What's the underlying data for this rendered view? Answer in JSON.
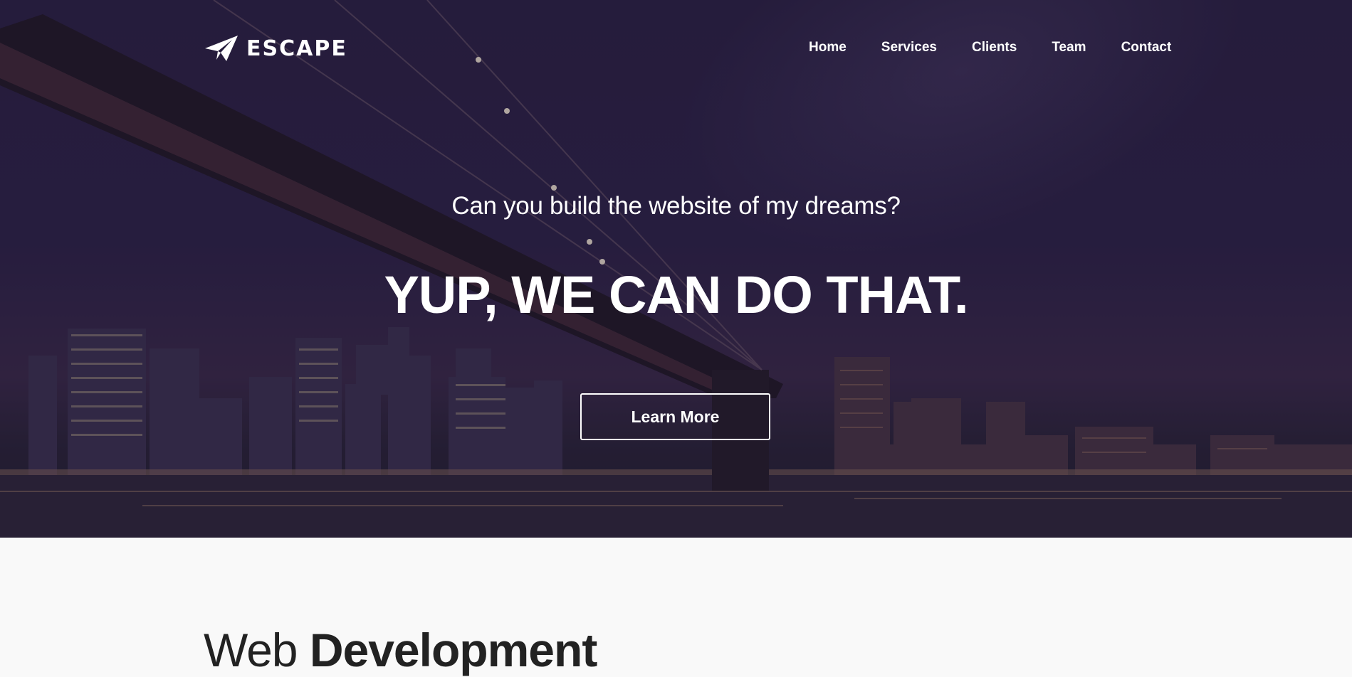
{
  "header": {
    "logo_text": "ESCAPE",
    "logo_icon": "paper-plane-icon",
    "nav": [
      {
        "label": "Home"
      },
      {
        "label": "Services"
      },
      {
        "label": "Clients"
      },
      {
        "label": "Team"
      },
      {
        "label": "Contact"
      }
    ]
  },
  "hero": {
    "subtitle": "Can you build the website of my dreams?",
    "title": "YUP, WE CAN DO THAT.",
    "button_label": "Learn More",
    "background": "night-city-bridge-photo"
  },
  "section": {
    "heading_light": "Web",
    "heading_bold": "Development"
  },
  "colors": {
    "text_on_hero": "#ffffff",
    "hero_tint": "#2c2246",
    "page_bg": "#f9f9f9",
    "heading_text": "#222222"
  }
}
